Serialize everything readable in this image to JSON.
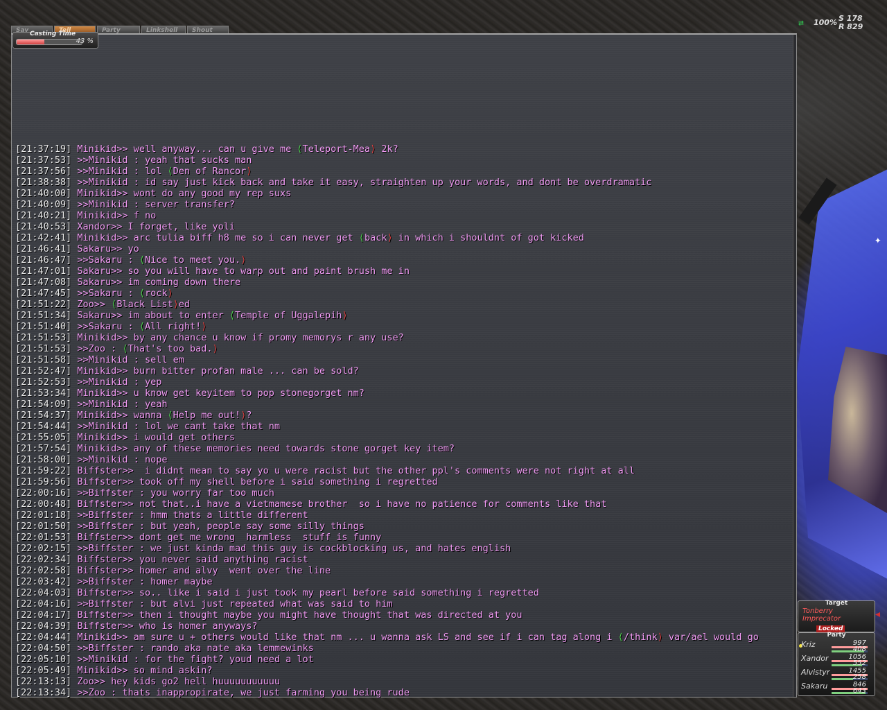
{
  "tabs": [
    {
      "label": "Say",
      "active": false
    },
    {
      "label": "Tell",
      "active": true
    },
    {
      "label": "Party",
      "active": false
    },
    {
      "label": "Linkshell",
      "active": false
    },
    {
      "label": "Shout",
      "active": false
    }
  ],
  "casting": {
    "label": "Casting Time",
    "percent_text": "43 %",
    "progress": 0.43
  },
  "compass": {
    "percent": "100%",
    "s": "S 178",
    "r": "R 829"
  },
  "chat": {
    "lines": [
      {
        "ts": "[21:37:19]",
        "text": " Minikid>> well anyway... can u give me ",
        "auto": "Teleport-Mea",
        "tail": " 2k?"
      },
      {
        "ts": "[21:37:53]",
        "text": " >>Minikid : yeah that sucks man"
      },
      {
        "ts": "[21:37:56]",
        "text": " >>Minikid : lol ",
        "auto": "Den of Rancor",
        "tail": ""
      },
      {
        "ts": "[21:38:38]",
        "text": " >>Minikid : id say just kick back and take it easy, straighten up your words, and dont be overdramatic"
      },
      {
        "ts": "[21:40:00]",
        "text": " Minikid>> wont do any good my rep suxs"
      },
      {
        "ts": "[21:40:09]",
        "text": " >>Minikid : server transfer?"
      },
      {
        "ts": "[21:40:21]",
        "text": " Minikid>> f no"
      },
      {
        "ts": "[21:40:53]",
        "text": " Xandor>> I forget, like yoli"
      },
      {
        "ts": "[21:42:41]",
        "text": " Minikid>> arc tulia biff h8 me so i can never get ",
        "auto": "back",
        "tail": " in which i shouldnt of got kicked"
      },
      {
        "ts": "[21:46:41]",
        "text": " Sakaru>> yo"
      },
      {
        "ts": "[21:46:47]",
        "text": " >>Sakaru : ",
        "auto": "Nice to meet you.",
        "tail": ""
      },
      {
        "ts": "[21:47:01]",
        "text": " Sakaru>> so you will have to warp out and paint brush me in"
      },
      {
        "ts": "[21:47:08]",
        "text": " Sakaru>> im coming down there"
      },
      {
        "ts": "[21:47:45]",
        "text": " >>Sakaru : ",
        "auto": "rock",
        "tail": ""
      },
      {
        "ts": "[21:51:22]",
        "text": " Zoo>> ",
        "auto": "Black List",
        "tail": "ed"
      },
      {
        "ts": "[21:51:34]",
        "text": " Sakaru>> im about to enter ",
        "auto": "Temple of Uggalepih",
        "tail": ""
      },
      {
        "ts": "[21:51:40]",
        "text": " >>Sakaru : ",
        "auto": "All right!",
        "tail": ""
      },
      {
        "ts": "[21:51:53]",
        "text": " Minikid>> by any chance u know if promy memorys r any use?"
      },
      {
        "ts": "[21:51:53]",
        "text": " >>Zoo : ",
        "auto": "That's too bad.",
        "tail": ""
      },
      {
        "ts": "[21:51:58]",
        "text": " >>Minikid : sell em"
      },
      {
        "ts": "[21:52:47]",
        "text": " Minikid>> burn bitter profan male ... can be sold?"
      },
      {
        "ts": "[21:52:53]",
        "text": " >>Minikid : yep"
      },
      {
        "ts": "[21:53:34]",
        "text": " Minikid>> u know get keyitem to pop stonegorget nm?"
      },
      {
        "ts": "[21:54:09]",
        "text": " >>Minikid : yeah"
      },
      {
        "ts": "[21:54:37]",
        "text": " Minikid>> wanna ",
        "auto": "Help me out!",
        "tail": "?"
      },
      {
        "ts": "[21:54:44]",
        "text": " >>Minikid : lol we cant take that nm"
      },
      {
        "ts": "[21:55:05]",
        "text": " Minikid>> i would get others"
      },
      {
        "ts": "[21:57:54]",
        "text": " Minikid>> any of these memories need towards stone gorget key item?"
      },
      {
        "ts": "[21:58:00]",
        "text": " >>Minikid : nope"
      },
      {
        "ts": "[21:59:22]",
        "text": " Biffster>>  i didnt mean to say yo u were racist but the other ppl's comments were not right at all"
      },
      {
        "ts": "[21:59:56]",
        "text": " Biffster>> took off my shell before i said something i regretted"
      },
      {
        "ts": "[22:00:16]",
        "text": " >>Biffster : you worry far too much"
      },
      {
        "ts": "[22:00:48]",
        "text": " Biffster>> not that..i have a vietmamese brother  so i have no patience for comments like that"
      },
      {
        "ts": "[22:01:18]",
        "text": " >>Biffster : hmm thats a little different"
      },
      {
        "ts": "[22:01:50]",
        "text": " >>Biffster : but yeah, people say some silly things"
      },
      {
        "ts": "[22:01:53]",
        "text": " Biffster>> dont get me wrong  harmless  stuff is funny"
      },
      {
        "ts": "[22:02:15]",
        "text": " >>Biffster : we just kinda mad this guy is cockblocking us, and hates english"
      },
      {
        "ts": "[22:02:34]",
        "text": " Biffster>> you never said anything racist"
      },
      {
        "ts": "[22:02:58]",
        "text": " Biffster>> homer and alvy  went over the line"
      },
      {
        "ts": "[22:03:42]",
        "text": " >>Biffster : homer maybe"
      },
      {
        "ts": "[22:04:03]",
        "text": " Biffster>> so.. like i said i just took my pearl before said something i regretted"
      },
      {
        "ts": "[22:04:16]",
        "text": " >>Biffster : but alvi just repeated what was said to him"
      },
      {
        "ts": "[22:04:17]",
        "text": " Biffster>> then i thought maybe you might have thought that was directed at you"
      },
      {
        "ts": "[22:04:39]",
        "text": " Biffster>> who is homer anyways?"
      },
      {
        "ts": "[22:04:44]",
        "text": " Minikid>> am sure u + others would like that nm ... u wanna ask LS and see if i can tag along i ",
        "auto": "/think",
        "tail": " var/ael would go"
      },
      {
        "ts": "[22:04:50]",
        "text": " >>Biffster : rando aka nate aka lemmewinks"
      },
      {
        "ts": "[22:05:10]",
        "text": " >>Minikid : for the fight? youd need a lot"
      },
      {
        "ts": "[22:05:49]",
        "text": " Minikid>> so mind askin?"
      },
      {
        "ts": "[22:13:13]",
        "text": " Zoo>> hey kids go2 hell huuuuuuuuuuu"
      },
      {
        "ts": "[22:13:34]",
        "text": " >>Zoo : thats inappropirate, we just farming you being rude"
      }
    ]
  },
  "target": {
    "header": "Target",
    "name_line1": "Tonberry",
    "name_line2": "Imprecator",
    "locked": "Locked"
  },
  "party": {
    "header": "Party",
    "members": [
      {
        "name": "Kriz",
        "hp": "997",
        "mp": "408",
        "hp_frac": 1.0,
        "mp_frac": 0.9,
        "selected": true
      },
      {
        "name": "Xandor",
        "hp": "1056",
        "mp": "552",
        "hp_frac": 1.0,
        "mp_frac": 0.85,
        "selected": false
      },
      {
        "name": "Alvistyr",
        "hp": "1455",
        "mp": "258",
        "hp_frac": 1.0,
        "mp_frac": 0.6,
        "selected": false
      },
      {
        "name": "Sakaru",
        "hp": "846",
        "mp": "643",
        "hp_frac": 1.0,
        "mp_frac": 0.95,
        "selected": false
      }
    ]
  },
  "colors": {
    "chat_text": "#ef9af2",
    "timestamp": "#e8e8e8",
    "autotrans_open": "#4bd24b",
    "autotrans_close": "#e04040",
    "target_name": "#ff5a5a"
  }
}
